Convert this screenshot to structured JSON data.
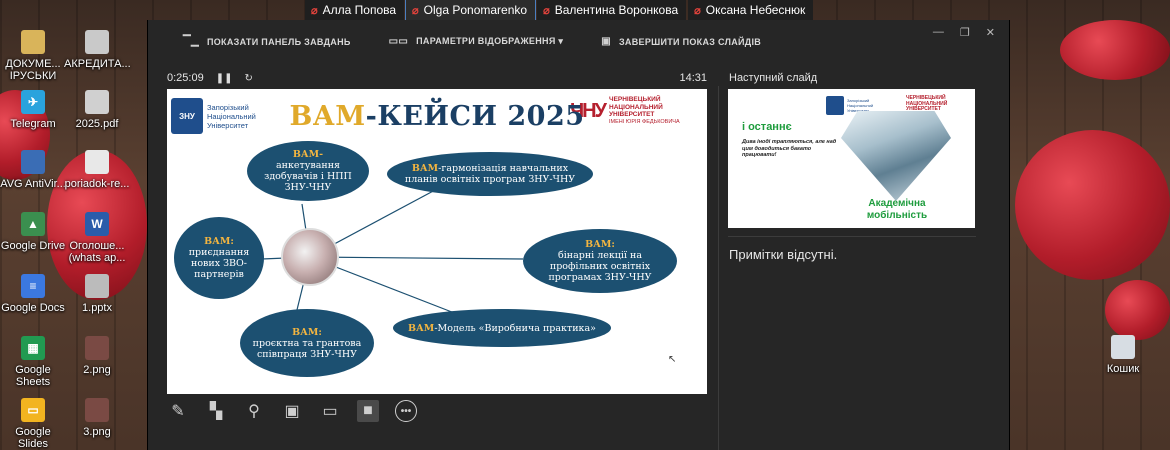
{
  "participants": [
    {
      "name": "Алла Попова",
      "active": false
    },
    {
      "name": "Olga Ponomarenko",
      "active": true
    },
    {
      "name": "Валентина Воронкова",
      "active": false
    },
    {
      "name": "Оксана Небеснюк",
      "active": false
    }
  ],
  "desktop_icons": [
    {
      "label": "ДОКУМЕ... ІРУСЬКИ",
      "icon": "folder-icon",
      "color": "#d9b45a",
      "mark": ""
    },
    {
      "label": "АКРЕДИТА...",
      "icon": "document-icon",
      "color": "#c9c9c9",
      "mark": ""
    },
    {
      "label": "Telegram",
      "icon": "telegram-icon",
      "color": "#2aa3dd",
      "mark": "✈"
    },
    {
      "label": "2025.pdf",
      "icon": "pdf-icon",
      "color": "#d0d0d0",
      "mark": ""
    },
    {
      "label": "AVG AntiVir...",
      "icon": "avg-icon",
      "color": "#3a6db5",
      "mark": ""
    },
    {
      "label": "poriadok-re...",
      "icon": "word-doc-icon",
      "color": "#e8e8e8",
      "mark": ""
    },
    {
      "label": "Google Drive",
      "icon": "google-drive-icon",
      "color": "#3b8f4f",
      "mark": "▲"
    },
    {
      "label": "Оголоше... (whats ap...",
      "icon": "word-doc-icon",
      "color": "#2b5caa",
      "mark": "W"
    },
    {
      "label": "Google Docs",
      "icon": "google-docs-icon",
      "color": "#3b78e0",
      "mark": "≡"
    },
    {
      "label": "1.pptx",
      "icon": "pptx-icon",
      "color": "#bbbbbb",
      "mark": ""
    },
    {
      "label": "Google Sheets",
      "icon": "google-sheets-icon",
      "color": "#219a51",
      "mark": "▦"
    },
    {
      "label": "2.png",
      "icon": "image-file-icon",
      "color": "#7a4a44",
      "mark": ""
    },
    {
      "label": "Google Slides",
      "icon": "google-slides-icon",
      "color": "#f2b420",
      "mark": "▭"
    },
    {
      "label": "3.png",
      "icon": "image-file-icon",
      "color": "#7a4a44",
      "mark": ""
    },
    {
      "label": "Кошик",
      "icon": "recycle-bin-icon",
      "color": "#d7dde3",
      "mark": ""
    }
  ],
  "toolbar": {
    "show_taskbar": "ПОКАЗАТИ ПАНЕЛЬ ЗАВДАНЬ",
    "display_settings": "ПАРАМЕТРИ ВІДОБРАЖЕННЯ ▾",
    "end_show": "ЗАВЕРШИТИ ПОКАЗ СЛАЙДІВ"
  },
  "timer": {
    "elapsed": "0:25:09",
    "clock": "14:31"
  },
  "next_slide_label": "Наступний слайд",
  "notes_text": "Примітки відсутні.",
  "slide": {
    "logo_left": "ЗНУ",
    "logo_left_text": "Запорізький Національний Університет",
    "logo_right_mark": "ЧНУ",
    "logo_right_text": "ЧЕРНІВЕЦЬКИЙ НАЦІОНАЛЬНИЙ УНІВЕРСИТЕТ",
    "logo_right_sub": "ІМЕНІ ЮРІЯ ФЕДЬКОВИЧА",
    "title_part1": "ВАМ",
    "title_part2": "-КЕЙСИ 2025",
    "nodes": {
      "survey": {
        "bold": "ВАМ-",
        "text": "анкетування здобувачів і НПП ЗНУ-ЧНУ"
      },
      "harmonize": {
        "bold": "ВАМ",
        "text": "-гармонізація навчальних планів освітніх програм ЗНУ-ЧНУ"
      },
      "partners": {
        "bold": "ВАМ:",
        "text": "приєднання нових ЗВО-партнерів"
      },
      "binary": {
        "bold": "ВАМ:",
        "text": "бінарні лекції на профільних освітніх програмах ЗНУ-ЧНУ"
      },
      "project": {
        "bold": "ВАМ:",
        "text": "проєктна та грантова співпраця ЗНУ-ЧНУ"
      },
      "practice": {
        "bold": "ВАМ",
        "text": "-Модель «Виробнича практика»"
      }
    }
  },
  "next_slide": {
    "title": "і останнє",
    "small_text": "Дива іноді трапляються, але над цим доводиться багато працювати!",
    "footer": "Академічна мобільність",
    "logo_right_text": "ЧЕРНІВЕЦЬКИЙ НАЦІОНАЛЬНИЙ УНІВЕРСИТЕТ",
    "logo_left_text": "Запорізький Національний Університет"
  },
  "bottom_tools": [
    {
      "name": "pen-tool-icon",
      "glyph": "✎"
    },
    {
      "name": "see-all-slides-icon",
      "glyph": "▚"
    },
    {
      "name": "zoom-icon",
      "glyph": "⚲"
    },
    {
      "name": "black-screen-icon",
      "glyph": "▣"
    },
    {
      "name": "subtitles-icon",
      "glyph": "▭"
    },
    {
      "name": "camera-icon",
      "glyph": "■"
    },
    {
      "name": "more-options-icon",
      "glyph": "•••"
    }
  ]
}
